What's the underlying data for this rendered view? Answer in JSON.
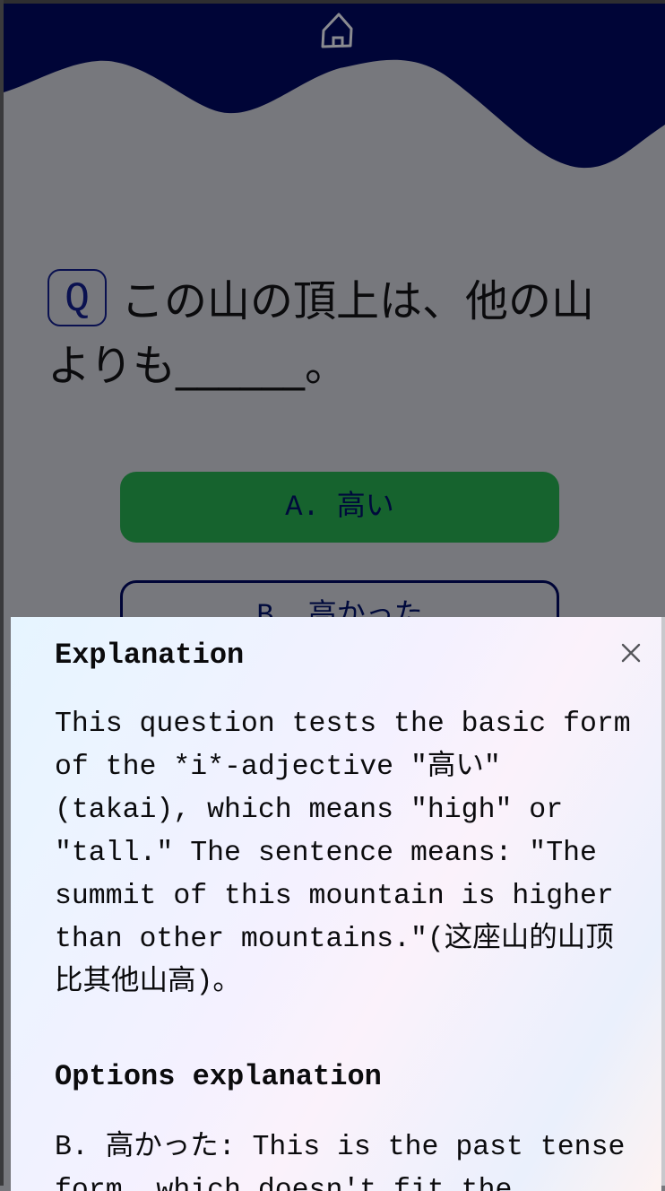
{
  "header": {
    "home_icon": "home-icon"
  },
  "question": {
    "badge": "Q",
    "text": "この山の頂上は、他の山よりも______。"
  },
  "options": [
    {
      "label": "A. 高い",
      "state": "correct",
      "color": "#16632e"
    },
    {
      "label": "B. 高かった",
      "state": "default"
    }
  ],
  "explanation_sheet": {
    "title": "Explanation",
    "text": "This question tests the basic form of the *i*-adjective \"高い\" (takai), which means \"high\" or \"tall.\" The sentence means: \"The summit of this mountain is higher than other mountains.\"(这座山的山顶比其他山高)。",
    "options_title": "Options explanation",
    "options_text": "B. 高かった: This is the past tense form, which doesn't fit the"
  },
  "colors": {
    "navy": "#000537",
    "overlay": "#77787d",
    "green": "#16632e"
  }
}
